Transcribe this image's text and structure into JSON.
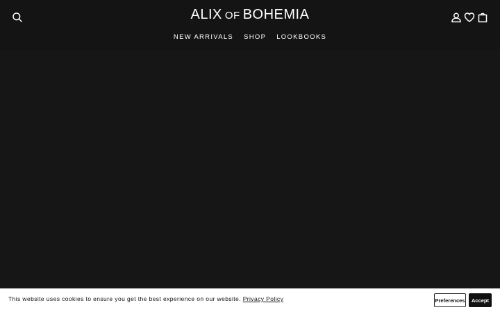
{
  "header": {
    "logo": {
      "part1": "ALIX",
      "part2": "OF",
      "part3": "BOHEMIA"
    },
    "icons": [
      "search-icon",
      "account-icon",
      "heart-icon",
      "cart-icon"
    ]
  },
  "nav": {
    "items": [
      {
        "label": "NEW ARRIVALS"
      },
      {
        "label": "SHOP"
      },
      {
        "label": "LOOKBOOKS"
      }
    ]
  },
  "cookie": {
    "message": "This website uses cookies to ensure you get the best experience on our website.",
    "policy_link": "Privacy Policy",
    "preferences_label": "Preferences",
    "accept_label": "Accept"
  },
  "colors": {
    "background": "#161616",
    "header": "#141414",
    "text": "#ffffff",
    "cookie_bg": "#ffffff",
    "accept_bg": "#111111"
  }
}
